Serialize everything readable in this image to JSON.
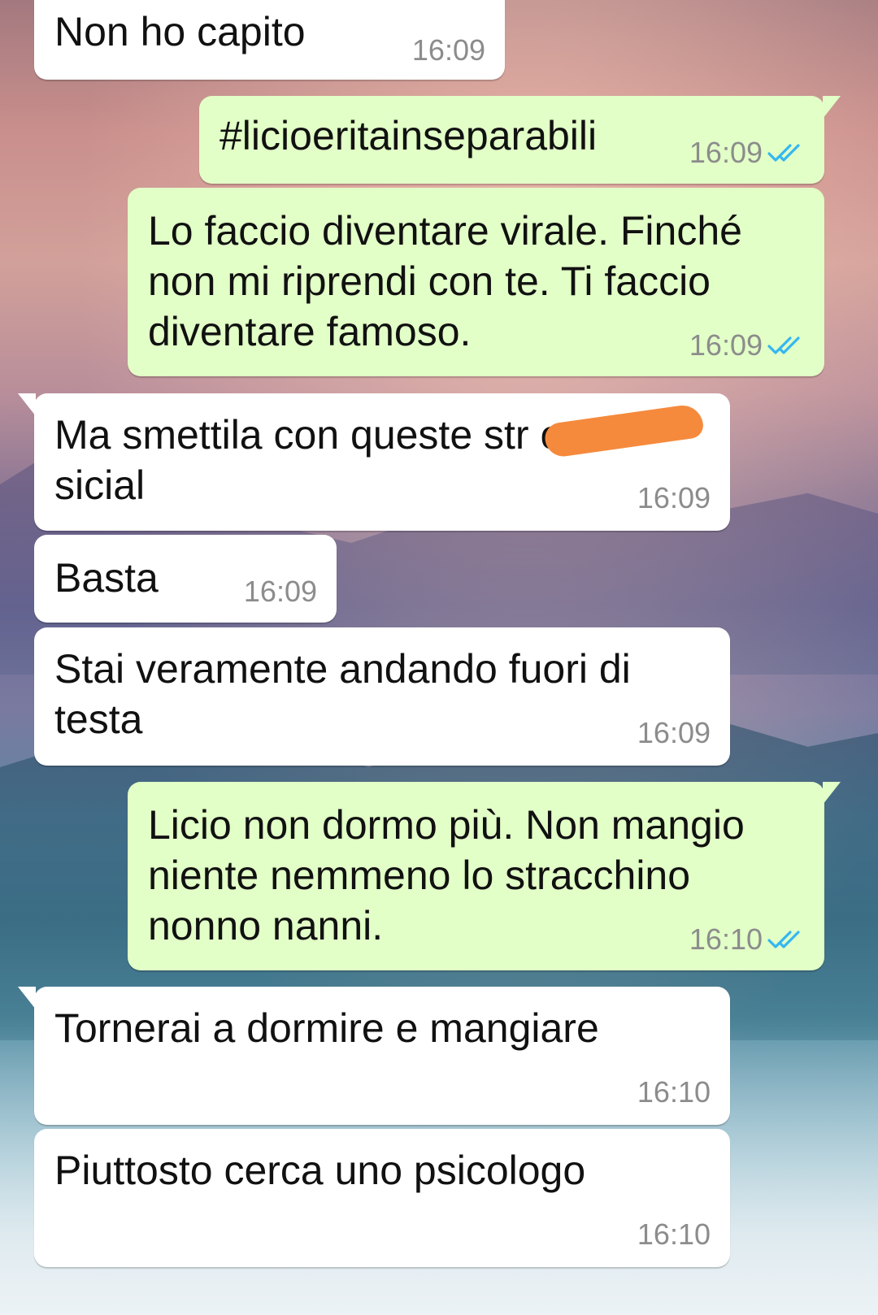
{
  "colors": {
    "incoming_bubble": "#ffffff",
    "outgoing_bubble": "#e2ffc7",
    "timestamp": "#8c8c8c",
    "read_receipt": "#34b7f1",
    "redaction": "#f58a3c"
  },
  "icons": {
    "read_receipt": "double-check-icon"
  },
  "messages": [
    {
      "direction": "incoming",
      "text": "Non ho capito",
      "time": "16:09"
    },
    {
      "direction": "outgoing",
      "text": "#licioeritainseparabili",
      "time": "16:09",
      "status": "read"
    },
    {
      "direction": "outgoing",
      "text": "Lo faccio diventare virale. Finché\nnon mi riprendi con te. Ti faccio\ndiventare famoso.",
      "time": "16:09",
      "status": "read"
    },
    {
      "direction": "incoming",
      "text": "Ma smettila con queste str        e\nsicial",
      "time": "16:09",
      "redacted": true
    },
    {
      "direction": "incoming",
      "text": "Basta",
      "time": "16:09"
    },
    {
      "direction": "incoming",
      "text": "Stai veramente andando fuori di\ntesta",
      "time": "16:09"
    },
    {
      "direction": "outgoing",
      "text": "Licio non dormo più. Non mangio\nniente nemmeno lo stracchino\nnonno nanni.",
      "time": "16:10",
      "status": "read"
    },
    {
      "direction": "incoming",
      "text": "Tornerai a dormire e mangiare",
      "time": "16:10"
    },
    {
      "direction": "incoming",
      "text": "Piuttosto cerca uno psicologo",
      "time": "16:10"
    }
  ]
}
